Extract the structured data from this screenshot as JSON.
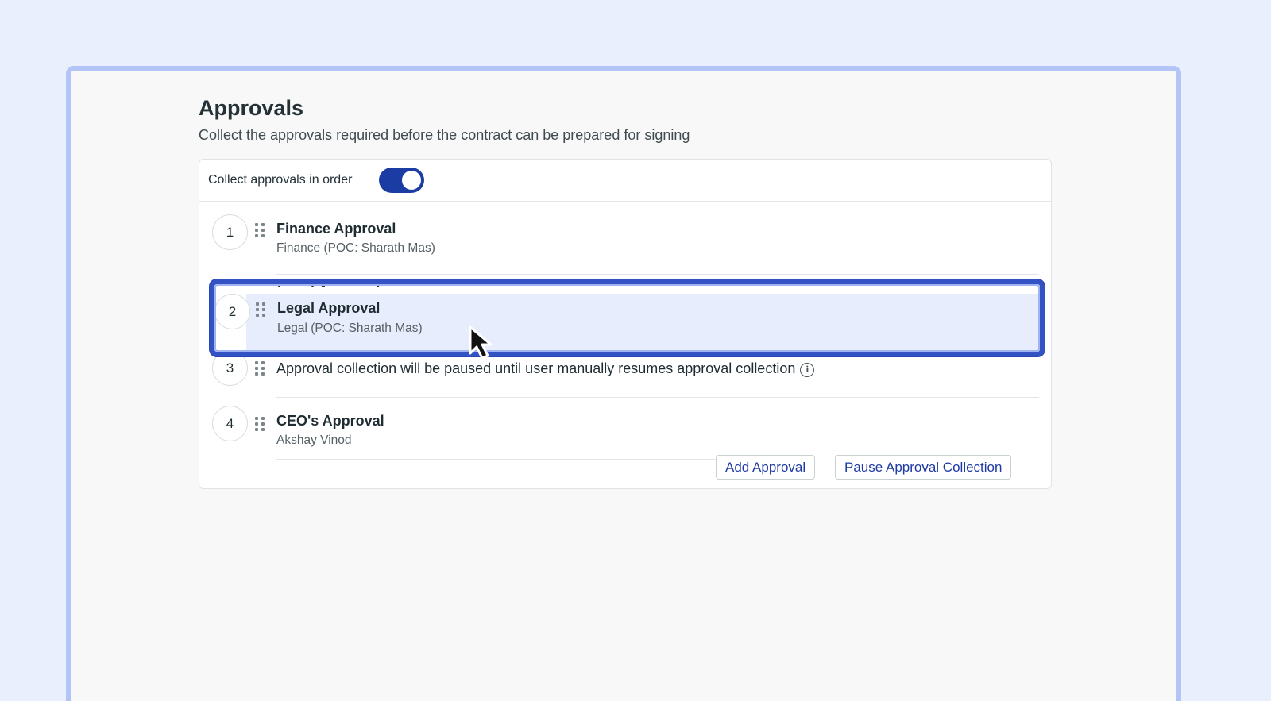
{
  "page": {
    "title": "Approvals",
    "subtitle": "Collect the approvals required before the contract can be prepared for signing"
  },
  "settings": {
    "toggle_label": "Collect approvals in order",
    "toggle_on": true
  },
  "steps": [
    {
      "number": "1",
      "title": "Finance Approval",
      "subtitle": "Finance (POC: Sharath Mas)"
    },
    {
      "number": "2",
      "title": "Legal Approval",
      "subtitle": "Legal (POC: Sharath Mas)"
    },
    {
      "number": "3",
      "text": "Approval collection will be paused until user manually resumes approval collection",
      "icon": "info-icon"
    },
    {
      "number": "4",
      "title": "CEO's Approval",
      "subtitle": "Akshay Vinod"
    }
  ],
  "actions": {
    "add_approval": "Add Approval",
    "pause_collection": "Pause Approval Collection"
  },
  "colors": {
    "background": "#e9effd",
    "accent": "#1b3da3",
    "drag_highlight_border": "#3352c3",
    "drag_highlight_fill": "#e7edfc"
  }
}
